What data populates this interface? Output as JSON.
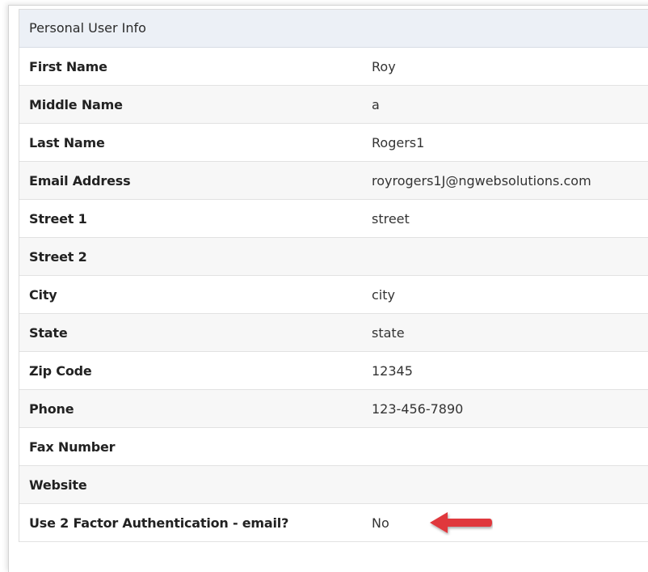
{
  "panel": {
    "title": "Personal User Info"
  },
  "rows": [
    {
      "label": "First Name",
      "value": "Roy"
    },
    {
      "label": "Middle Name",
      "value": "a"
    },
    {
      "label": "Last Name",
      "value": "Rogers1"
    },
    {
      "label": "Email Address",
      "value": "royrogers1J@ngwebsolutions.com"
    },
    {
      "label": "Street 1",
      "value": "street"
    },
    {
      "label": "Street 2",
      "value": ""
    },
    {
      "label": "City",
      "value": "city"
    },
    {
      "label": "State",
      "value": "state"
    },
    {
      "label": "Zip Code",
      "value": "12345"
    },
    {
      "label": "Phone",
      "value": "123-456-7890"
    },
    {
      "label": "Fax Number",
      "value": ""
    },
    {
      "label": "Website",
      "value": ""
    },
    {
      "label": "Use 2 Factor Authentication - email?",
      "value": "No"
    }
  ],
  "colors": {
    "heading_bg": "#ecf0f6",
    "stripe_bg": "#f7f7f7",
    "annotation_arrow": "#e0383e"
  },
  "annotation": {
    "icon": "left-arrow-icon"
  }
}
